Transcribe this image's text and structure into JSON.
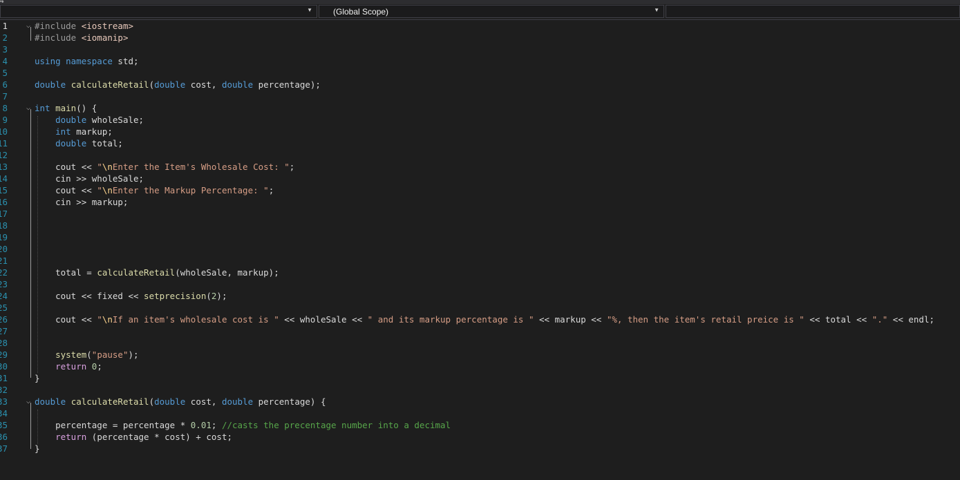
{
  "nav": {
    "left_value": "",
    "scope": "(Global Scope)",
    "corner": "4"
  },
  "colors": {
    "keyword": "#569cd6",
    "control": "#d8a0df",
    "string": "#d69d85",
    "comment": "#57a64a",
    "number": "#b5cea8",
    "line_number": "#2b91af",
    "background": "#1e1e1e"
  },
  "lines": [
    {
      "n": "1",
      "fold": "⌵",
      "current": true,
      "tokens": [
        [
          "pp",
          "#include "
        ],
        [
          "inc",
          "<iostream>"
        ]
      ]
    },
    {
      "n": "2",
      "tokens": [
        [
          "pp",
          "#include "
        ],
        [
          "inc",
          "<iomanip>"
        ]
      ]
    },
    {
      "n": "3",
      "tokens": []
    },
    {
      "n": "4",
      "tokens": [
        [
          "kw",
          "using namespace "
        ],
        [
          "id",
          "std;"
        ]
      ]
    },
    {
      "n": "5",
      "tokens": []
    },
    {
      "n": "6",
      "tokens": [
        [
          "kw",
          "double "
        ],
        [
          "fn",
          "calculateRetail"
        ],
        [
          "id",
          "("
        ],
        [
          "kw",
          "double "
        ],
        [
          "id",
          "cost, "
        ],
        [
          "kw",
          "double "
        ],
        [
          "id",
          "percentage);"
        ]
      ]
    },
    {
      "n": "7",
      "tokens": []
    },
    {
      "n": "8",
      "fold": "⌵",
      "tokens": [
        [
          "kw",
          "int "
        ],
        [
          "fn",
          "main"
        ],
        [
          "id",
          "() {"
        ]
      ]
    },
    {
      "n": "9",
      "tokens": [
        [
          "id",
          "    "
        ],
        [
          "kw",
          "double "
        ],
        [
          "id",
          "wholeSale;"
        ]
      ]
    },
    {
      "n": "10",
      "tokens": [
        [
          "id",
          "    "
        ],
        [
          "kw",
          "int "
        ],
        [
          "id",
          "markup;"
        ]
      ]
    },
    {
      "n": "11",
      "tokens": [
        [
          "id",
          "    "
        ],
        [
          "kw",
          "double "
        ],
        [
          "id",
          "total;"
        ]
      ]
    },
    {
      "n": "12",
      "tokens": []
    },
    {
      "n": "13",
      "tokens": [
        [
          "id",
          "    cout << "
        ],
        [
          "str",
          "\""
        ],
        [
          "esc",
          "\\n"
        ],
        [
          "str",
          "Enter the Item's Wholesale Cost: \""
        ],
        [
          "id",
          ";"
        ]
      ]
    },
    {
      "n": "14",
      "tokens": [
        [
          "id",
          "    cin >> wholeSale;"
        ]
      ]
    },
    {
      "n": "15",
      "tokens": [
        [
          "id",
          "    cout << "
        ],
        [
          "str",
          "\""
        ],
        [
          "esc",
          "\\n"
        ],
        [
          "str",
          "Enter the Markup Percentage: \""
        ],
        [
          "id",
          ";"
        ]
      ]
    },
    {
      "n": "16",
      "tokens": [
        [
          "id",
          "    cin >> markup;"
        ]
      ]
    },
    {
      "n": "17",
      "tokens": []
    },
    {
      "n": "18",
      "tokens": []
    },
    {
      "n": "19",
      "tokens": []
    },
    {
      "n": "20",
      "tokens": []
    },
    {
      "n": "21",
      "tokens": []
    },
    {
      "n": "22",
      "tokens": [
        [
          "id",
          "    total = "
        ],
        [
          "fn",
          "calculateRetail"
        ],
        [
          "id",
          "(wholeSale, markup);"
        ]
      ]
    },
    {
      "n": "23",
      "tokens": []
    },
    {
      "n": "24",
      "tokens": [
        [
          "id",
          "    cout << fixed << "
        ],
        [
          "fn",
          "setprecision"
        ],
        [
          "id",
          "("
        ],
        [
          "num",
          "2"
        ],
        [
          "id",
          ");"
        ]
      ]
    },
    {
      "n": "25",
      "tokens": []
    },
    {
      "n": "26",
      "tokens": [
        [
          "id",
          "    cout << "
        ],
        [
          "str",
          "\""
        ],
        [
          "esc",
          "\\n"
        ],
        [
          "str",
          "If an item's wholesale cost is \""
        ],
        [
          "id",
          " << wholeSale << "
        ],
        [
          "str",
          "\" and its markup percentage is \""
        ],
        [
          "id",
          " << markup << "
        ],
        [
          "str",
          "\"%, then the item's retail preice is \""
        ],
        [
          "id",
          " << total << "
        ],
        [
          "str",
          "\".\""
        ],
        [
          "id",
          " << endl;"
        ]
      ]
    },
    {
      "n": "27",
      "tokens": []
    },
    {
      "n": "28",
      "tokens": []
    },
    {
      "n": "29",
      "tokens": [
        [
          "id",
          "    "
        ],
        [
          "fn",
          "system"
        ],
        [
          "id",
          "("
        ],
        [
          "str",
          "\"pause\""
        ],
        [
          "id",
          ");"
        ]
      ]
    },
    {
      "n": "30",
      "tokens": [
        [
          "id",
          "    "
        ],
        [
          "kw2",
          "return "
        ],
        [
          "num",
          "0"
        ],
        [
          "id",
          ";"
        ]
      ]
    },
    {
      "n": "31",
      "tokens": [
        [
          "id",
          "}"
        ]
      ]
    },
    {
      "n": "32",
      "tokens": []
    },
    {
      "n": "33",
      "fold": "⌵",
      "tokens": [
        [
          "kw",
          "double "
        ],
        [
          "fn",
          "calculateRetail"
        ],
        [
          "id",
          "("
        ],
        [
          "kw",
          "double "
        ],
        [
          "id",
          "cost, "
        ],
        [
          "kw",
          "double "
        ],
        [
          "id",
          "percentage) {"
        ]
      ]
    },
    {
      "n": "34",
      "tokens": []
    },
    {
      "n": "35",
      "tokens": [
        [
          "id",
          "    percentage = percentage * "
        ],
        [
          "num",
          "0.01"
        ],
        [
          "id",
          "; "
        ],
        [
          "cmt",
          "//casts the precentage number into a decimal"
        ]
      ]
    },
    {
      "n": "36",
      "tokens": [
        [
          "id",
          "    "
        ],
        [
          "kw2",
          "return "
        ],
        [
          "id",
          "(percentage * cost) + cost;"
        ]
      ]
    },
    {
      "n": "37",
      "tokens": [
        [
          "id",
          "}"
        ]
      ]
    }
  ]
}
